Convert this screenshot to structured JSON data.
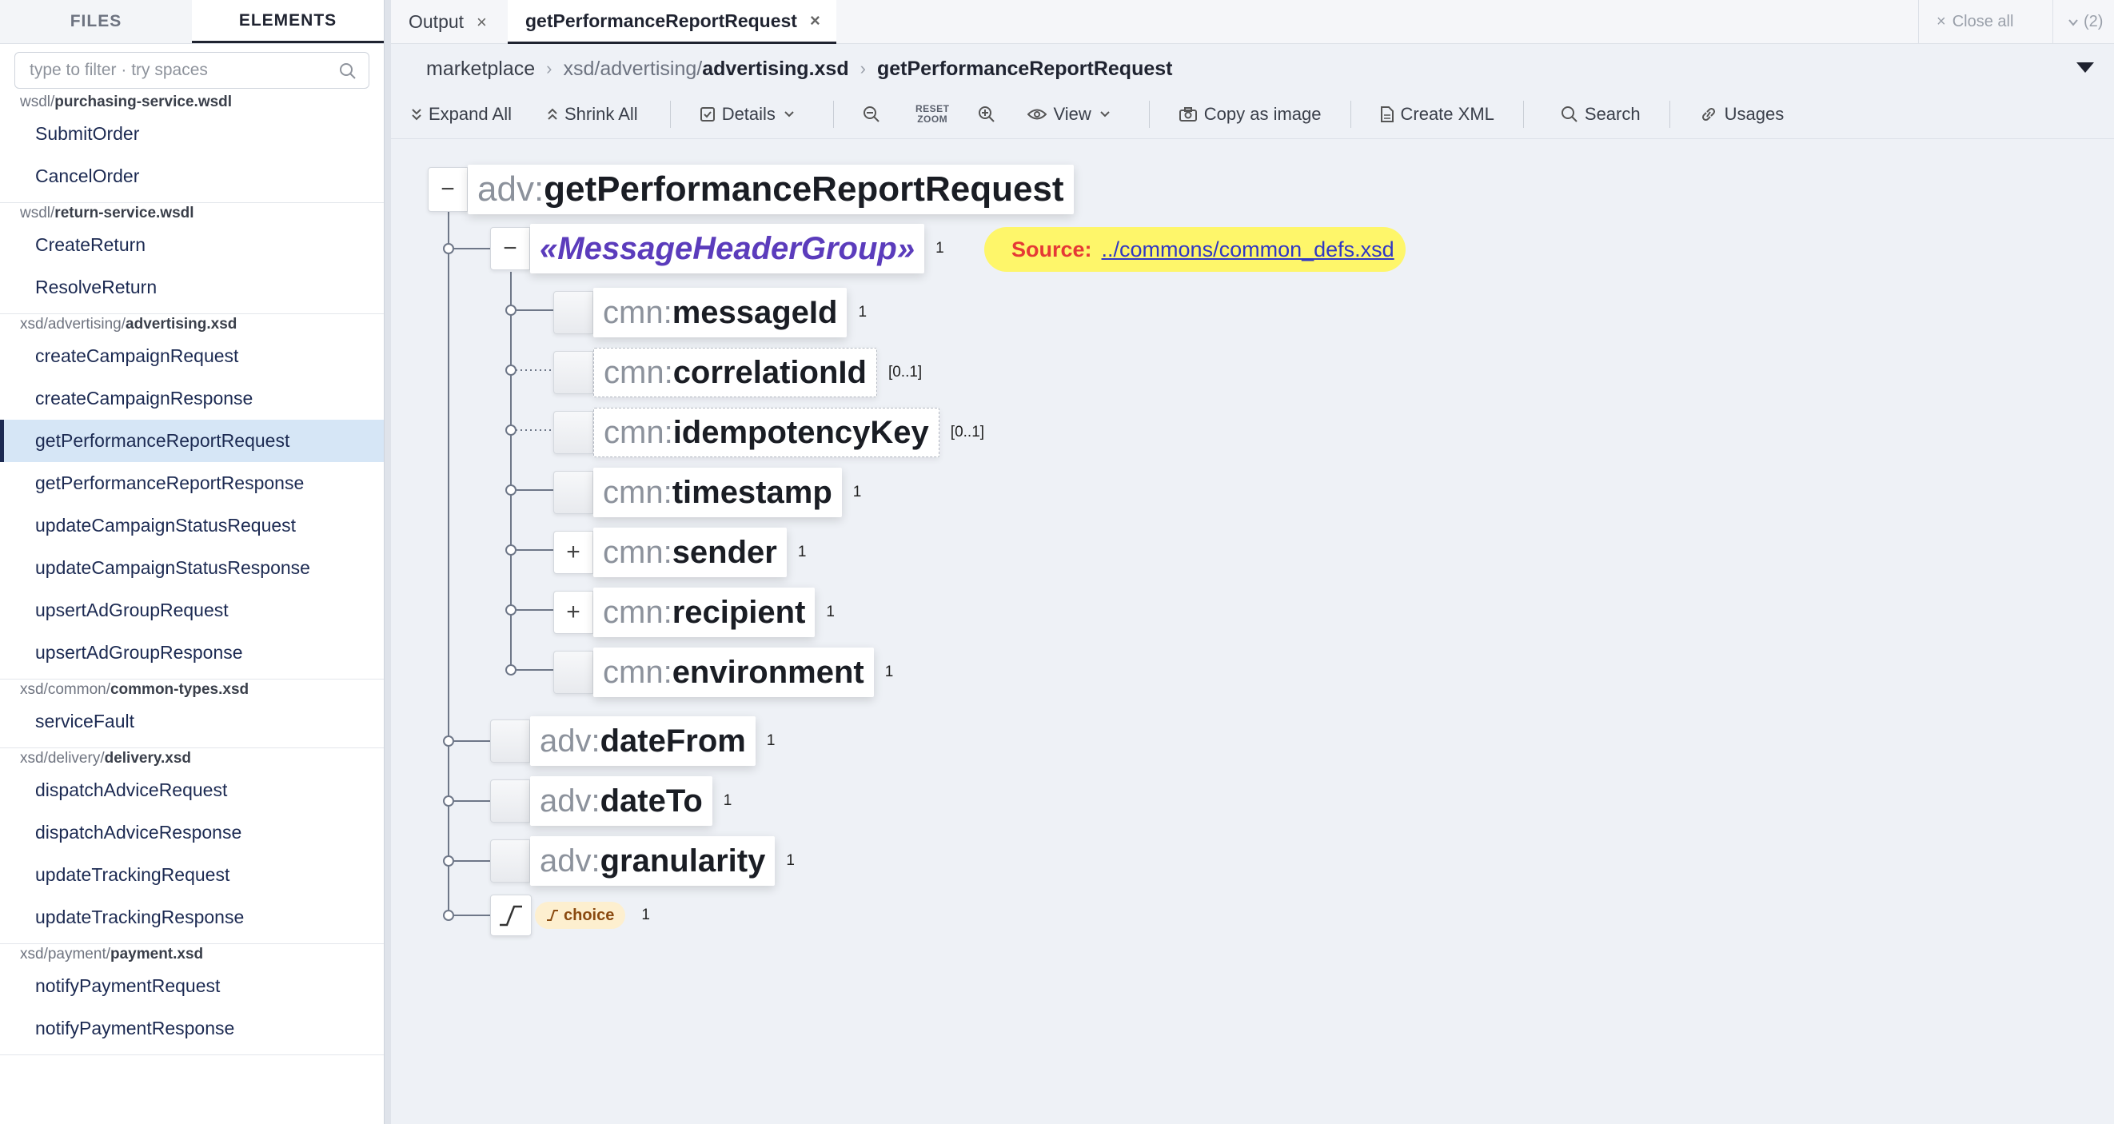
{
  "sidebar": {
    "tabs": [
      "FILES",
      "ELEMENTS"
    ],
    "filter_placeholder": "type to filter · try spaces",
    "groups": [
      {
        "dir": "wsdl/",
        "file": "purchasing-service.wsdl",
        "items": [
          "SubmitOrder",
          "CancelOrder"
        ]
      },
      {
        "dir": "wsdl/",
        "file": "return-service.wsdl",
        "items": [
          "CreateReturn",
          "ResolveReturn"
        ]
      },
      {
        "dir": "xsd/advertising/",
        "file": "advertising.xsd",
        "items": [
          "createCampaignRequest",
          "createCampaignResponse",
          "getPerformanceReportRequest",
          "getPerformanceReportResponse",
          "updateCampaignStatusRequest",
          "updateCampaignStatusResponse",
          "upsertAdGroupRequest",
          "upsertAdGroupResponse"
        ]
      },
      {
        "dir": "xsd/common/",
        "file": "common-types.xsd",
        "items": [
          "serviceFault"
        ]
      },
      {
        "dir": "xsd/delivery/",
        "file": "delivery.xsd",
        "items": [
          "dispatchAdviceRequest",
          "dispatchAdviceResponse",
          "updateTrackingRequest",
          "updateTrackingResponse"
        ]
      },
      {
        "dir": "xsd/payment/",
        "file": "payment.xsd",
        "items": [
          "notifyPaymentRequest",
          "notifyPaymentResponse"
        ]
      }
    ],
    "selected": "getPerformanceReportRequest"
  },
  "tabs": {
    "output": "Output",
    "active": "getPerformanceReportRequest",
    "close_all": "Close all",
    "count": "(2)"
  },
  "breadcrumb": {
    "root": "marketplace",
    "dir": "xsd/advertising/",
    "file": "advertising.xsd",
    "element": "getPerformanceReportRequest"
  },
  "toolbar": {
    "expand_all": "Expand All",
    "shrink_all": "Shrink All",
    "details": "Details",
    "reset_zoom_1": "RESET",
    "reset_zoom_2": "ZOOM",
    "view": "View",
    "copy_image": "Copy as image",
    "create_xml": "Create XML",
    "search": "Search",
    "usages": "Usages"
  },
  "diagram": {
    "root": {
      "prefix": "adv:",
      "name": "getPerformanceReportRequest"
    },
    "group": {
      "name": "«MessageHeaderGroup»",
      "card": "1",
      "source_label": "Source:",
      "source_link": "../commons/common_defs.xsd"
    },
    "group_children": [
      {
        "prefix": "cmn:",
        "name": "messageId",
        "card": "1",
        "optional": false,
        "expandable": false
      },
      {
        "prefix": "cmn:",
        "name": "correlationId",
        "card": "[0..1]",
        "optional": true,
        "expandable": false
      },
      {
        "prefix": "cmn:",
        "name": "idempotencyKey",
        "card": "[0..1]",
        "optional": true,
        "expandable": false
      },
      {
        "prefix": "cmn:",
        "name": "timestamp",
        "card": "1",
        "optional": false,
        "expandable": false
      },
      {
        "prefix": "cmn:",
        "name": "sender",
        "card": "1",
        "optional": false,
        "expandable": true
      },
      {
        "prefix": "cmn:",
        "name": "recipient",
        "card": "1",
        "optional": false,
        "expandable": true
      },
      {
        "prefix": "cmn:",
        "name": "environment",
        "card": "1",
        "optional": false,
        "expandable": false
      }
    ],
    "root_children": [
      {
        "prefix": "adv:",
        "name": "dateFrom",
        "card": "1"
      },
      {
        "prefix": "adv:",
        "name": "dateTo",
        "card": "1"
      },
      {
        "prefix": "adv:",
        "name": "granularity",
        "card": "1"
      }
    ],
    "choice": {
      "label": "choice",
      "card": "1"
    }
  },
  "colors": {
    "accent": "#1c2a52",
    "group": "#5b3cbc",
    "source_bg": "#fef66a",
    "source_label": "#e53935",
    "selected_bg": "#d6e6f6"
  }
}
